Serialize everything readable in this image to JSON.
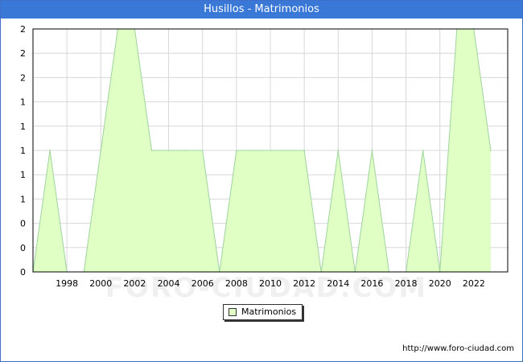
{
  "window": {
    "title": "Husillos - Matrimonios"
  },
  "watermark": "FORO-CIUDAD.COM",
  "footer": {
    "url": "http://www.foro-ciudad.com"
  },
  "legend": {
    "items": [
      {
        "label": "Matrimonios",
        "color": "#dfffc5"
      }
    ]
  },
  "colors": {
    "area_fill": "#dfffc5",
    "line": "#9fd49f",
    "grid": "#d8d8d8",
    "titlebar": "#3a78d8"
  },
  "chart_data": {
    "type": "area",
    "title": "Husillos - Matrimonios",
    "xlabel": "",
    "ylabel": "",
    "x": [
      1996,
      1997,
      1998,
      1999,
      2000,
      2001,
      2002,
      2003,
      2004,
      2005,
      2006,
      2007,
      2008,
      2009,
      2010,
      2011,
      2012,
      2013,
      2014,
      2015,
      2016,
      2017,
      2018,
      2019,
      2020,
      2021,
      2022,
      2023
    ],
    "series": [
      {
        "name": "Matrimonios",
        "values": [
          0,
          1,
          0,
          0,
          1,
          2,
          2,
          1,
          1,
          1,
          1,
          0,
          1,
          1,
          1,
          1,
          1,
          0,
          1,
          0,
          1,
          0,
          0,
          1,
          0,
          2,
          2,
          1
        ]
      }
    ],
    "xlim": [
      1996,
      2024
    ],
    "ylim": [
      0,
      2
    ],
    "x_ticks": [
      "1998",
      "2000",
      "2002",
      "2004",
      "2006",
      "2008",
      "2010",
      "2012",
      "2014",
      "2016",
      "2018",
      "2020",
      "2022"
    ],
    "y_tick_labels": [
      "0",
      "0",
      "0",
      "1",
      "1",
      "1",
      "1",
      "1",
      "2",
      "2",
      "2"
    ],
    "grid": true,
    "legend_position": "bottom-center"
  }
}
